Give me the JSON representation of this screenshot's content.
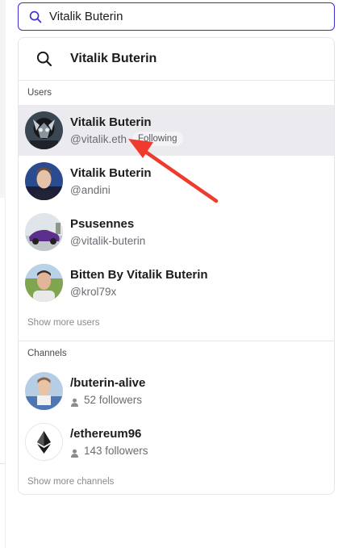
{
  "search": {
    "value": "Vitalik Buterin"
  },
  "dropdown": {
    "query_suggestion": "Vitalik Buterin",
    "users_heading": "Users",
    "users": [
      {
        "name": "Vitalik Buterin",
        "handle": "@vitalik.eth",
        "badge": "Following",
        "highlighted": true
      },
      {
        "name": "Vitalik Buterin",
        "handle": "@andini",
        "badge": null,
        "highlighted": false
      },
      {
        "name": "Psusennes",
        "handle": "@vitalik-buterin",
        "badge": null,
        "highlighted": false
      },
      {
        "name": "Bitten By Vitalik Buterin",
        "handle": "@krol79x",
        "badge": null,
        "highlighted": false
      }
    ],
    "show_more_users": "Show more users",
    "channels_heading": "Channels",
    "channels": [
      {
        "name": "/buterin-alive",
        "followers": "52 followers"
      },
      {
        "name": "/ethereum96",
        "followers": "143 followers"
      }
    ],
    "show_more_channels": "Show more channels"
  },
  "colors": {
    "accent": "#3b2bd0",
    "highlight_row": "#ebebef",
    "annotation_arrow": "#f03a2e"
  },
  "icons": {
    "search": "search-icon",
    "user": "user-icon",
    "ethereum": "ethereum-icon"
  }
}
